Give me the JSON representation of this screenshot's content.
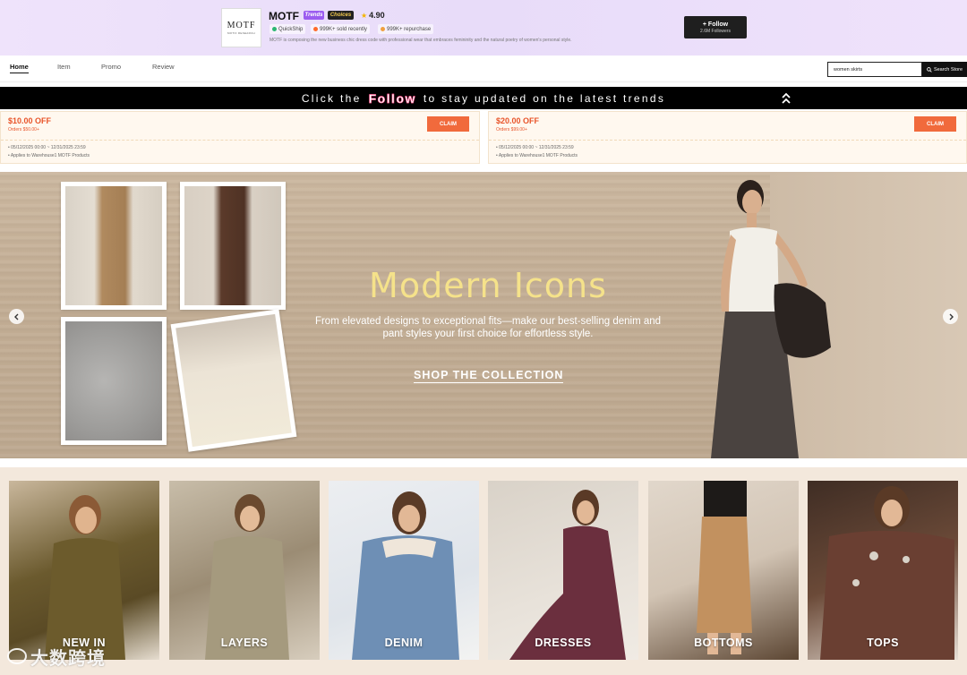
{
  "store": {
    "logo_text": "MOTF",
    "logo_sub": "MOTIF RESEARCH",
    "name": "MOTF",
    "badge_trends": "Trends",
    "badge_choices": "Choices",
    "rating": "4.90",
    "tags": [
      "QuickShip",
      "999K+ sold recently",
      "999K+ repurchase"
    ],
    "description": "MOTF is composing the new business chic dress code with professional wear that embraces femininity and the natural poetry of women's personal style.",
    "follow_label": "+ Follow",
    "followers": "2.6M Followers"
  },
  "nav": {
    "tabs": [
      "Home",
      "Item",
      "Promo",
      "Review"
    ],
    "search_value": "women skirts",
    "search_button": "Search Store"
  },
  "follow_banner": {
    "pre": "Click the",
    "highlight": "Follow",
    "post": "to stay updated on the latest trends"
  },
  "coupons": [
    {
      "amount": "$10.00 OFF",
      "min": "Orders $50.00+",
      "date": "• 05/12/2025 00:00 ~ 12/31/2025 23:59",
      "applies": "• Applies to Warehouse1 MOTF Products",
      "claim": "CLAIM"
    },
    {
      "amount": "$20.00 OFF",
      "min": "Orders $99.00+",
      "date": "• 05/12/2025 00:00 ~ 12/31/2025 23:59",
      "applies": "• Applies to Warehouse1 MOTF Products",
      "claim": "CLAIM"
    }
  ],
  "hero": {
    "title": "Modern Icons",
    "subtitle": "From elevated designs to exceptional fits—make our best-selling denim and pant styles your first choice for effortless style.",
    "cta": "SHOP THE COLLECTION"
  },
  "categories": [
    "NEW IN",
    "LAYERS",
    "DENIM",
    "DRESSES",
    "BOTTOMS",
    "TOPS"
  ],
  "watermark": "大数跨境",
  "colors": {
    "accent": "#f16a3c",
    "hero_title": "#f5e28a",
    "header_bg": "#efe3fb"
  }
}
